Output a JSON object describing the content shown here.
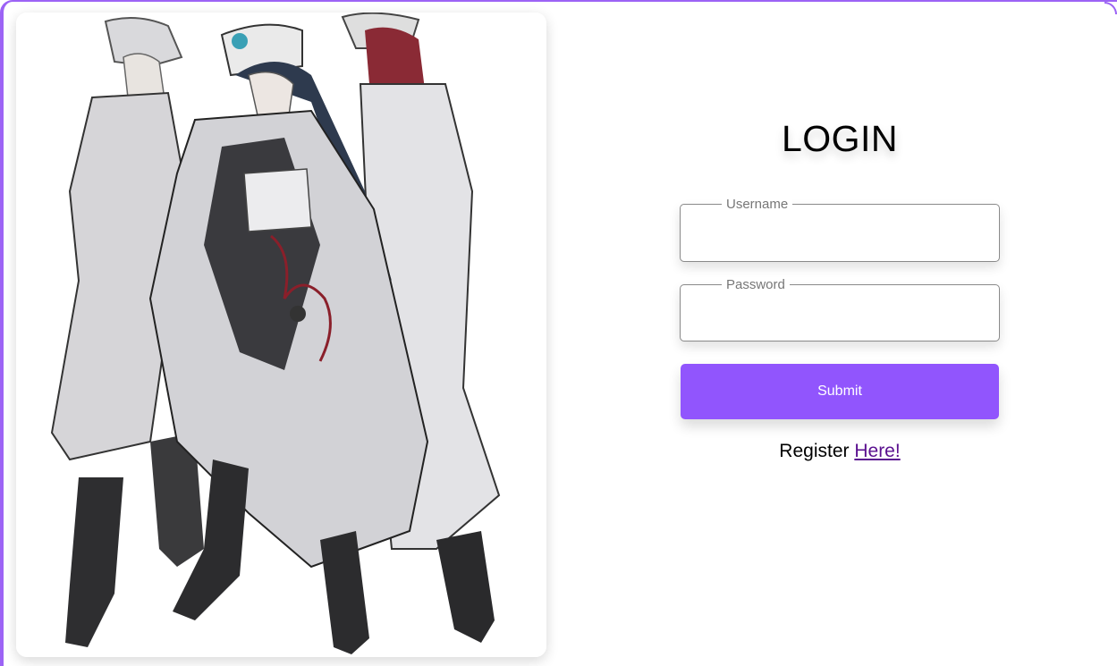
{
  "login": {
    "title": "LOGIN",
    "username_label": "Username",
    "username_value": "",
    "password_label": "Password",
    "password_value": "",
    "submit_label": "Submit",
    "register_prefix": "Register",
    "register_link": "Here!"
  },
  "image": {
    "description_icon": "character-illustration"
  },
  "colors": {
    "accent": "#9155fd",
    "frame_border": "#9c63f5",
    "link": "#5a0f8f"
  }
}
